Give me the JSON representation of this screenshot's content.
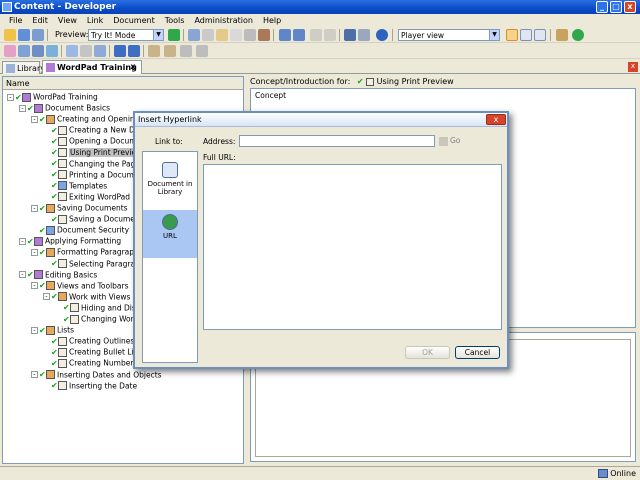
{
  "window": {
    "title": "Content - Developer",
    "controls": [
      "_",
      "□",
      "x"
    ]
  },
  "menu": [
    "File",
    "Edit",
    "View",
    "Link",
    "Document",
    "Tools",
    "Administration",
    "Help"
  ],
  "toolbar": {
    "preview_label": "Preview:",
    "mode_value": "Try It! Mode",
    "player_value": "Player view"
  },
  "tabs": [
    {
      "label": "Library",
      "active": false
    },
    {
      "label": "WordPad Training",
      "active": true
    }
  ],
  "tab_close_glyph": "x",
  "tree_header": "Name",
  "tree": [
    {
      "label": "WordPad Training",
      "level": 0,
      "type": "module",
      "exp": "-",
      "check": true
    },
    {
      "label": "Document Basics",
      "level": 1,
      "type": "module",
      "exp": "-",
      "check": true
    },
    {
      "label": "Creating and Opening Do",
      "level": 2,
      "type": "section",
      "exp": "-",
      "check": true
    },
    {
      "label": "Creating a New Docu",
      "level": 3,
      "type": "topic",
      "check": true
    },
    {
      "label": "Opening a Document",
      "level": 3,
      "type": "topic",
      "check": true
    },
    {
      "label": "Using Print Preview",
      "level": 3,
      "type": "topic",
      "check": true,
      "selected": true
    },
    {
      "label": "Changing the Page S",
      "level": 3,
      "type": "topic",
      "check": true
    },
    {
      "label": "Printing a Document",
      "level": 3,
      "type": "topic",
      "check": true
    },
    {
      "label": "Templates",
      "level": 3,
      "type": "doc",
      "check": true
    },
    {
      "label": "Exiting WordPad",
      "level": 3,
      "type": "topic",
      "check": true
    },
    {
      "label": "Saving Documents",
      "level": 2,
      "type": "section",
      "exp": "-",
      "check": true
    },
    {
      "label": "Saving a Document ar",
      "level": 3,
      "type": "topic",
      "check": true
    },
    {
      "label": "Document Security",
      "level": 2,
      "type": "doc",
      "check": true
    },
    {
      "label": "Applying Formatting",
      "level": 1,
      "type": "module",
      "exp": "-",
      "check": true
    },
    {
      "label": "Formatting Paragraphs",
      "level": 2,
      "type": "section",
      "exp": "-",
      "check": true
    },
    {
      "label": "Selecting Paragraph T",
      "level": 3,
      "type": "topic",
      "check": true
    },
    {
      "label": "Editing Basics",
      "level": 1,
      "type": "module",
      "exp": "-",
      "check": true
    },
    {
      "label": "Views and Toolbars",
      "level": 2,
      "type": "section",
      "exp": "-",
      "check": true
    },
    {
      "label": "Work with Views",
      "level": 3,
      "type": "section",
      "exp": "-",
      "check": true
    },
    {
      "label": "Hiding and Display",
      "level": 4,
      "type": "topic",
      "check": true
    },
    {
      "label": "Changing Word W",
      "level": 4,
      "type": "topic",
      "check": true
    },
    {
      "label": "Lists",
      "level": 2,
      "type": "section",
      "exp": "-",
      "check": true
    },
    {
      "label": "Creating Outlines",
      "level": 3,
      "type": "topic",
      "check": true
    },
    {
      "label": "Creating Bullet Lists",
      "level": 3,
      "type": "topic",
      "check": true
    },
    {
      "label": "Creating Number Lists",
      "level": 3,
      "type": "topic",
      "check": true
    },
    {
      "label": "Inserting Dates and Objects",
      "level": 2,
      "type": "section",
      "exp": "-",
      "check": true
    },
    {
      "label": "Inserting the Date",
      "level": 3,
      "type": "topic",
      "check": true
    }
  ],
  "right_panel": {
    "concept_prefix": "Concept/Introduction for:",
    "concept_topic": "Using Print Preview",
    "concept_label": "Concept"
  },
  "status": {
    "text": "Online"
  },
  "dialog": {
    "title": "Insert Hyperlink",
    "close_glyph": "x",
    "link_to_label": "Link to:",
    "options": [
      {
        "label": "Document in Library",
        "icon": "document-library-icon",
        "selected": false
      },
      {
        "label": "URL",
        "icon": "globe-icon",
        "selected": true
      }
    ],
    "address_label": "Address:",
    "address_value": "",
    "go_label": "Go",
    "full_url_label": "Full URL:",
    "ok_label": "OK",
    "cancel_label": "Cancel"
  },
  "colors": {
    "titlebar": "#0a4bc7",
    "check": "#14a514",
    "selected_option": "#a9c7f2"
  }
}
